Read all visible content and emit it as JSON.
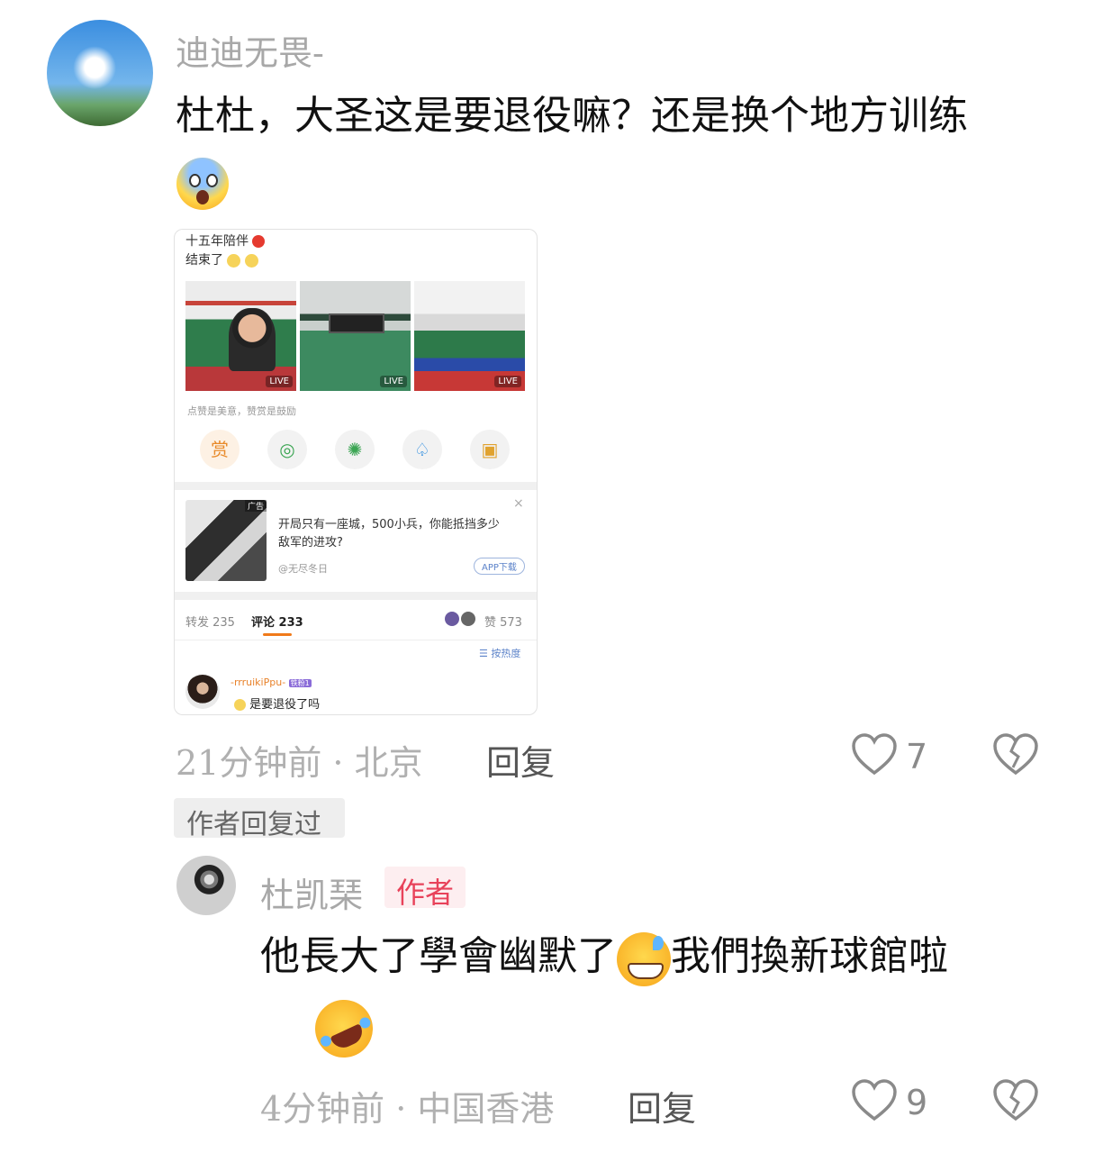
{
  "comment1": {
    "username": "迪迪无畏-",
    "text_line1": "杜杜，大圣这是要退役嘛？还是换个地方训练",
    "emoji_icon": "scream-emoji",
    "time": "21分钟前 · 北京",
    "reply": "回复",
    "likes": "7",
    "badge": "作者回复过"
  },
  "screenshot": {
    "post_line1": "十五年陪伴",
    "post_line2": "结束了",
    "live_label": "LIVE",
    "reward_hint": "点赞是美意，赞赏是鼓励",
    "reward_btn": "赏",
    "ad_tag": "广告",
    "ad_text_line1": "开局只有一座城，500小兵，你能抵挡多少",
    "ad_text_line2": "敌军的进攻?",
    "ad_source": "@无尽冬日",
    "ad_button": "APP下载",
    "tab_repost": "转发 235",
    "tab_comment": "评论 233",
    "tab_like": "赞 573",
    "sort": "按热度",
    "sub_user": "-rrruikiPpu-",
    "sub_badge": "铁粉1",
    "sub_text": "是要退役了吗"
  },
  "comment2": {
    "username": "杜凯琹",
    "author_tag": "作者",
    "text_line1a": "他長大了學會幽默了",
    "text_line1b": "我們換新球館啦",
    "emoji_icon_1": "grin-sweat-emoji",
    "emoji_icon_2": "rofl-emoji",
    "time": "4分钟前 · 中国香港",
    "reply": "回复",
    "likes": "9"
  },
  "colors": {
    "author_tag_bg": "#fdeef0",
    "author_tag_text": "#e8425a",
    "accent_orange": "#f07a1a"
  }
}
